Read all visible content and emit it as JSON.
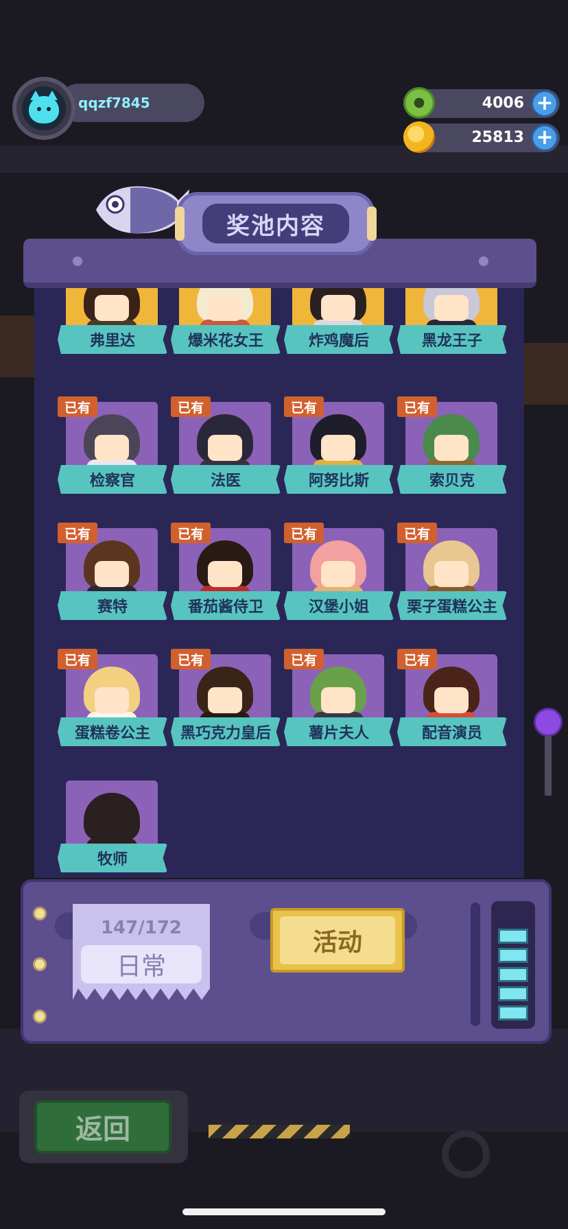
{
  "player": {
    "username": "qqzf7845",
    "avatar_icon": "cat-avatar-icon"
  },
  "currencies": [
    {
      "name": "donut-coin",
      "value": "4006",
      "color": "#7cc043"
    },
    {
      "name": "planet-coin",
      "value": "25813",
      "color": "#f2b51e"
    }
  ],
  "pool": {
    "title": "奖池内容",
    "owned_label": "已有",
    "characters": [
      {
        "name": "弗里达",
        "owned": false,
        "tier": "gold",
        "hair": "#3a2218",
        "body": "#4a3a2a"
      },
      {
        "name": "爆米花女王",
        "owned": false,
        "tier": "gold",
        "hair": "#f4ead0",
        "body": "#c85a3a"
      },
      {
        "name": "炸鸡魔后",
        "owned": false,
        "tier": "gold",
        "hair": "#2a2020",
        "body": "#d8d8e0"
      },
      {
        "name": "黑龙王子",
        "owned": false,
        "tier": "gold",
        "hair": "#c8c8d8",
        "body": "#2a2838"
      },
      {
        "name": "检察官",
        "owned": true,
        "tier": "purple",
        "hair": "#4a4658",
        "body": "#e8e8f0"
      },
      {
        "name": "法医",
        "owned": true,
        "tier": "purple",
        "hair": "#2a2838",
        "body": "#3a3040"
      },
      {
        "name": "阿努比斯",
        "owned": true,
        "tier": "purple",
        "hair": "#1e1e2a",
        "body": "#e0b040"
      },
      {
        "name": "索贝克",
        "owned": true,
        "tier": "purple",
        "hair": "#4a8a4a",
        "body": "#8a6a30"
      },
      {
        "name": "赛特",
        "owned": true,
        "tier": "purple",
        "hair": "#5a3620",
        "body": "#2a2838"
      },
      {
        "name": "番茄酱侍卫",
        "owned": true,
        "tier": "purple",
        "hair": "#2a1a14",
        "body": "#c02a2a"
      },
      {
        "name": "汉堡小姐",
        "owned": true,
        "tier": "purple",
        "hair": "#f2a0a0",
        "body": "#e8b070"
      },
      {
        "name": "栗子蛋糕公主",
        "owned": true,
        "tier": "purple",
        "hair": "#e8c890",
        "body": "#8a5a2a"
      },
      {
        "name": "蛋糕卷公主",
        "owned": true,
        "tier": "purple",
        "hair": "#f2d080",
        "body": "#fff4e8"
      },
      {
        "name": "黑巧克力皇后",
        "owned": true,
        "tier": "purple",
        "hair": "#3a2418",
        "body": "#2a1a14"
      },
      {
        "name": "薯片夫人",
        "owned": true,
        "tier": "purple",
        "hair": "#6aa04a",
        "body": "#3a3848"
      },
      {
        "name": "配音演员",
        "owned": true,
        "tier": "purple",
        "hair": "#4a2418",
        "body": "#d84a3a"
      },
      {
        "name": "牧师",
        "owned": false,
        "tier": "locked",
        "hair": "#2a2020",
        "body": "#2a2020"
      }
    ]
  },
  "tickets": {
    "daily_count": "147/172",
    "daily_label": "日常",
    "event_label": "活动"
  },
  "meter_level": 5,
  "back_label": "返回"
}
